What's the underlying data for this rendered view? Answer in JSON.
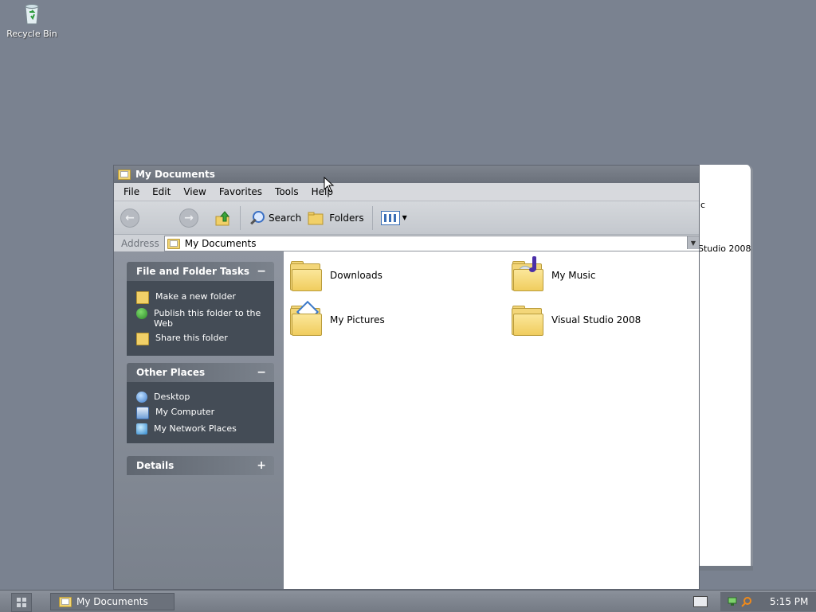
{
  "desktop": {
    "icons": [
      {
        "label": "Recycle Bin",
        "icon": "recycle-bin-icon"
      }
    ]
  },
  "background_window": {
    "text_1": "ic",
    "text_2": "Studio 2008"
  },
  "window": {
    "title": "My Documents",
    "menu": [
      "File",
      "Edit",
      "View",
      "Favorites",
      "Tools",
      "Help"
    ],
    "toolbar": {
      "search_label": "Search",
      "folders_label": "Folders"
    },
    "address": {
      "label": "Address",
      "value": "My Documents"
    },
    "tasks": {
      "file_folder": {
        "title": "File and Folder Tasks",
        "toggle": "−",
        "items": [
          "Make a new folder",
          "Publish this folder to the Web",
          "Share this folder"
        ]
      },
      "other_places": {
        "title": "Other Places",
        "toggle": "−",
        "items": [
          "Desktop",
          "My Computer",
          "My Network Places"
        ]
      },
      "details": {
        "title": "Details",
        "toggle": "+"
      }
    },
    "items": [
      {
        "label": "Downloads",
        "icon": "folder-icon"
      },
      {
        "label": "My Music",
        "icon": "music-folder-icon"
      },
      {
        "label": "My Pictures",
        "icon": "pictures-folder-icon"
      },
      {
        "label": "Visual Studio 2008",
        "icon": "folder-icon"
      }
    ]
  },
  "taskbar": {
    "task_label": "My Documents",
    "clock": "5:15 PM"
  }
}
